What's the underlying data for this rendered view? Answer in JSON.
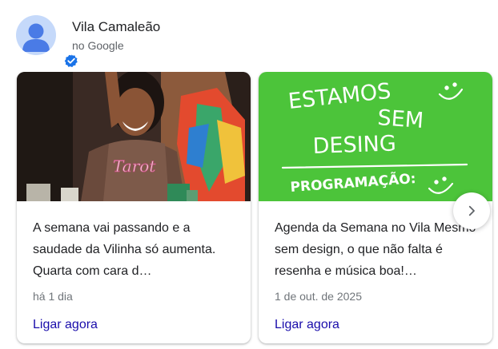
{
  "business": {
    "name": "Vila Camaleão",
    "subtitle": "no Google"
  },
  "posts": [
    {
      "text": "A semana vai passando e a saudade da Vilinha só aumenta. Quarta com cara d…",
      "date": "há 1 dia",
      "cta": "Ligar agora",
      "image_text": "Tarot"
    },
    {
      "text": "Agenda da Semana no Vila Mesmo sem design, o que não falta é resenha e música boa!…",
      "date": "1 de out. de 2025",
      "cta": "Ligar agora",
      "image_lines": [
        "ESTAMOS",
        "SEM",
        "DESING",
        "PROGRAMAÇÃO:"
      ]
    }
  ],
  "icons": {
    "avatar": "person-avatar-icon",
    "verified": "verified-badge-icon",
    "next": "chevron-right-icon"
  },
  "colors": {
    "link": "#1a0dab",
    "verified": "#1a73e8",
    "green_post": "#4cc43a"
  }
}
